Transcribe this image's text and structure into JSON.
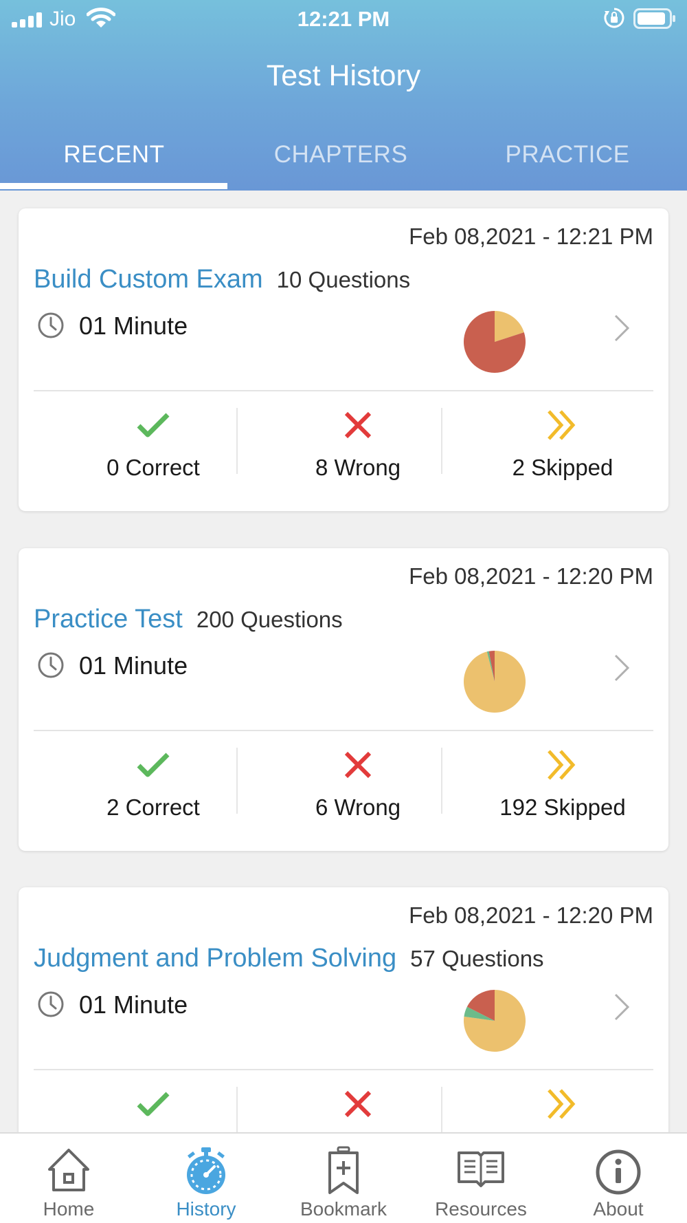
{
  "status_bar": {
    "carrier": "Jio",
    "time": "12:21 PM"
  },
  "header": {
    "title": "Test History"
  },
  "tabs": [
    {
      "label": "RECENT",
      "active": true
    },
    {
      "label": "CHAPTERS",
      "active": false
    },
    {
      "label": "PRACTICE",
      "active": false
    }
  ],
  "colors": {
    "correct": "#5cb85c",
    "wrong": "#e23b3b",
    "skipped": "#f2bb2a",
    "pie_wrong": "#c9604f",
    "pie_skipped": "#ecc16e",
    "pie_correct": "#6cbb8a",
    "accent": "#3a8ec5"
  },
  "cards": [
    {
      "date": "Feb 08,2021 - 12:21 PM",
      "name": "Build Custom Exam",
      "questions": "10 Questions",
      "duration": "01 Minute",
      "correct_label": "0 Correct",
      "wrong_label": "8 Wrong",
      "skipped_label": "2 Skipped",
      "pie": {
        "correct": 0,
        "wrong": 8,
        "skipped": 2
      }
    },
    {
      "date": "Feb 08,2021 - 12:20 PM",
      "name": "Practice Test",
      "questions": "200 Questions",
      "duration": "01 Minute",
      "correct_label": "2 Correct",
      "wrong_label": "6 Wrong",
      "skipped_label": "192 Skipped",
      "pie": {
        "correct": 2,
        "wrong": 6,
        "skipped": 192
      }
    },
    {
      "date": "Feb 08,2021 - 12:20 PM",
      "name": "Judgment and Problem Solving",
      "questions": "57 Questions",
      "duration": "01 Minute",
      "pie": {
        "correct": 3,
        "wrong": 10,
        "skipped": 44
      }
    }
  ],
  "bottom_nav": [
    {
      "label": "Home",
      "icon": "home-icon",
      "active": false
    },
    {
      "label": "History",
      "icon": "stopwatch-icon",
      "active": true
    },
    {
      "label": "Bookmark",
      "icon": "bookmark-add-icon",
      "active": false
    },
    {
      "label": "Resources",
      "icon": "book-icon",
      "active": false
    },
    {
      "label": "About",
      "icon": "info-icon",
      "active": false
    }
  ]
}
